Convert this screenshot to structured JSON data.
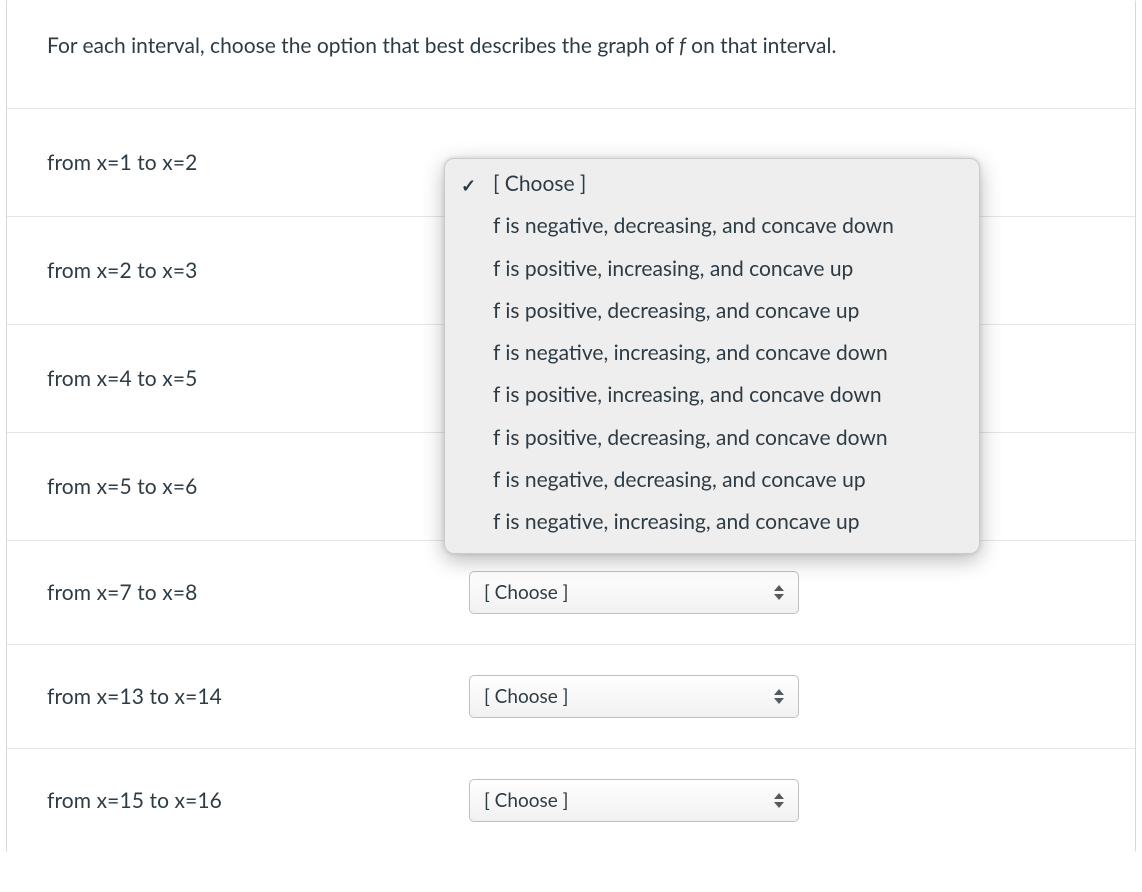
{
  "instructions": {
    "prefix": "For each interval, choose the option that best describes the graph of ",
    "fvar": "f",
    "suffix": " on that interval."
  },
  "select_placeholder": "[ Choose ]",
  "rows": [
    {
      "label": "from x=1 to x=2"
    },
    {
      "label": "from x=2 to x=3"
    },
    {
      "label": "from x=4 to x=5"
    },
    {
      "label": "from x=5 to x=6"
    },
    {
      "label": "from x=7 to x=8"
    },
    {
      "label": "from x=13 to x=14"
    },
    {
      "label": "from x=15 to x=16"
    }
  ],
  "dropdown": {
    "selected_index": 0,
    "options": [
      "[ Choose ]",
      "f is negative, decreasing, and concave down",
      "f is positive, increasing, and concave up",
      "f is positive, decreasing, and concave up",
      "f is negative, increasing, and concave down",
      "f is positive, increasing, and concave down",
      "f is positive, decreasing, and concave down",
      "f is negative, decreasing, and concave up",
      "f is negative, increasing, and concave up"
    ]
  }
}
